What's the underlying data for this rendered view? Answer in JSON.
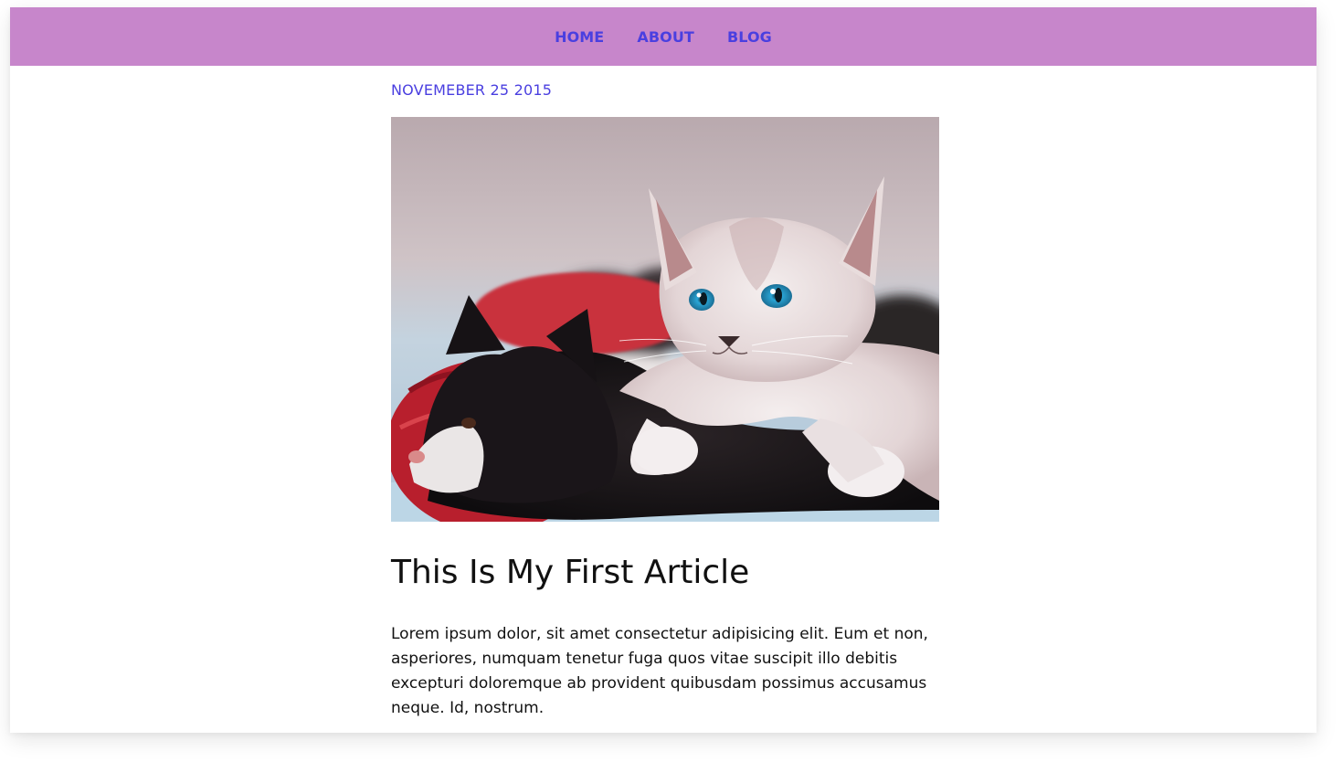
{
  "nav": {
    "items": [
      {
        "label": "HOME"
      },
      {
        "label": "ABOUT"
      },
      {
        "label": "BLOG"
      }
    ]
  },
  "article": {
    "date": "NOVEMEBER 25 2015",
    "image_alt": "Two kittens, one white and one black, lying on a blanket next to red yarn",
    "title": "This Is My First Article",
    "body": "Lorem ipsum dolor, sit amet consectetur adipisicing elit. Eum et non, asperiores, numquam tenetur fuga quos vitae suscipit illo debitis excepturi doloremque ab provident quibusdam possimus accusamus neque. Id, nostrum."
  },
  "colors": {
    "navbar_bg": "#c786cb",
    "nav_link": "#4a3fe0",
    "date": "#4a3fe0",
    "text": "#111111"
  }
}
